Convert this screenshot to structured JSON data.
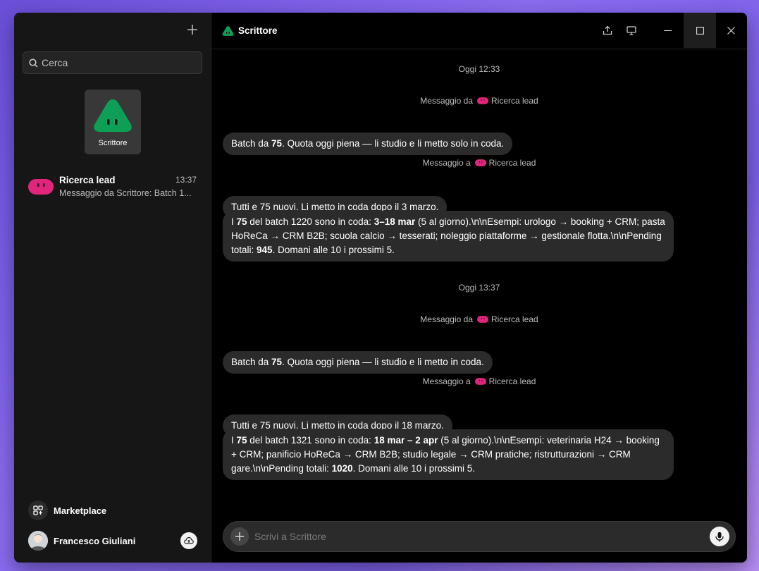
{
  "sidebar": {
    "search_placeholder": "Cerca",
    "agent_tile_label": "Scrittore",
    "chat": {
      "name": "Ricerca lead",
      "time": "13:37",
      "preview": "Messaggio da Scrittore: Batch 1..."
    },
    "marketplace_label": "Marketplace",
    "user_name": "Francesco Giuliani"
  },
  "header": {
    "title": "Scrittore"
  },
  "messages": {
    "ts1": "Oggi 12:33",
    "sys1_prefix": "Messaggio da",
    "sys1_name": "Ricerca lead",
    "b1": [
      "Batch da ",
      "75",
      ". Quota oggi piena — li studio e li metto solo in coda."
    ],
    "sys2_prefix": "Messaggio a",
    "sys2_name": "Ricerca lead",
    "b2": "Tutti e 75 nuovi. Li metto in coda dopo il 3 marzo.",
    "b3": [
      "I ",
      "75",
      " del batch 1220 sono in coda: ",
      "3–18 mar",
      " (5 al giorno).\\n\\nEsempi: urologo → booking + CRM; pasta HoReCa → CRM B2B; scuola calcio → tesserati; noleggio piattaforme → gestionale flotta.\\n\\nPending totali: ",
      "945",
      ". Domani alle 10 i prossimi 5."
    ],
    "ts2": "Oggi 13:37",
    "sys3_prefix": "Messaggio da",
    "sys3_name": "Ricerca lead",
    "b4": [
      "Batch da ",
      "75",
      ". Quota oggi piena — li studio e li metto in coda."
    ],
    "sys4_prefix": "Messaggio a",
    "sys4_name": "Ricerca lead",
    "b5": "Tutti e 75 nuovi. Li metto in coda dopo il 18 marzo.",
    "b6": [
      "I ",
      "75",
      " del batch 1321 sono in coda: ",
      "18 mar – 2 apr",
      " (5 al giorno).\\n\\nEsempi: veterinaria H24 → booking + CRM; panificio HoReCa → CRM B2B; studio legale → CRM pratiche; ristrutturazioni → CRM gare.\\n\\nPending totali: ",
      "1020",
      ". Domani alle 10 i prossimi 5."
    ]
  },
  "composer": {
    "placeholder": "Scrivi a Scrittore"
  },
  "colors": {
    "brand_green": "#0e9f57",
    "lead_pink": "#e2257c"
  }
}
